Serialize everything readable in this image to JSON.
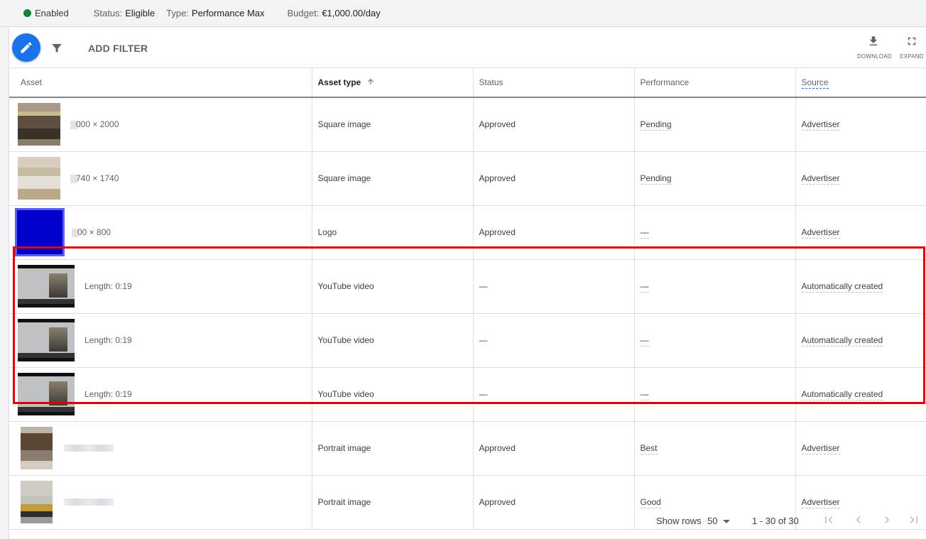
{
  "status_bar": {
    "state": "Enabled",
    "state_color": "#188038",
    "status_label": "Status:",
    "status_value": "Eligible",
    "type_label": "Type:",
    "type_value": "Performance Max",
    "budget_label": "Budget:",
    "budget_value": "€1,000.00/day"
  },
  "toolbar": {
    "edit_icon": "pencil-icon",
    "filter_icon": "filter-icon",
    "add_filter_label": "ADD FILTER",
    "download_label": "DOWNLOAD",
    "expand_label": "EXPAND"
  },
  "table": {
    "columns": [
      {
        "label": "Asset"
      },
      {
        "label": "Asset type",
        "sort": "ascending"
      },
      {
        "label": "Status"
      },
      {
        "label": "Performance"
      },
      {
        "label": "Source"
      }
    ],
    "rows": [
      {
        "asset": "000 × 2000",
        "type": "Square image",
        "status": "Approved",
        "performance": "Pending",
        "source": "Advertiser"
      },
      {
        "asset": "740 × 1740",
        "type": "Square image",
        "status": "Approved",
        "performance": "Pending",
        "source": "Advertiser"
      },
      {
        "asset": "00 × 800",
        "type": "Logo",
        "status": "Approved",
        "performance": "—",
        "source": "Advertiser"
      },
      {
        "asset": "Length: 0:19",
        "type": "YouTube video",
        "status": "—",
        "performance": "—",
        "source": "Automatically created"
      },
      {
        "asset": "Length: 0:19",
        "type": "YouTube video",
        "status": "—",
        "performance": "—",
        "source": "Automatically created"
      },
      {
        "asset": "Length: 0:19",
        "type": "YouTube video",
        "status": "—",
        "performance": "—",
        "source": "Automatically created"
      },
      {
        "asset": "",
        "type": "Portrait image",
        "status": "Approved",
        "performance": "Best",
        "source": "Advertiser"
      },
      {
        "asset": "",
        "type": "Portrait image",
        "status": "Approved",
        "performance": "Good",
        "source": "Advertiser"
      }
    ]
  },
  "highlight_color": "#e00000",
  "footer": {
    "show_rows_label": "Show rows",
    "show_rows_value": "50",
    "range": "1 - 30 of 30"
  }
}
